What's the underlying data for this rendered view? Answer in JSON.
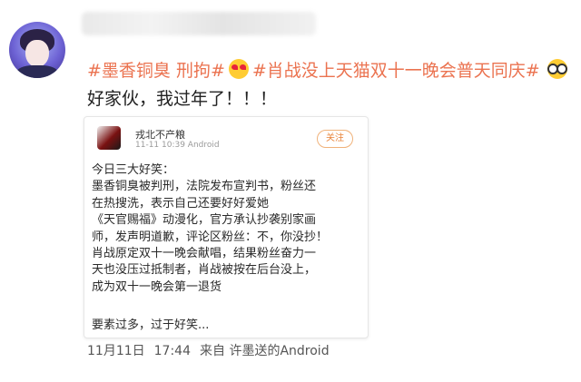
{
  "post": {
    "tags": [
      "#墨香铜臭 刑拘#",
      "#肖战没上天猫双十一晚会普天同庆#"
    ],
    "text": "好家伙，我过年了！！！",
    "emoji": [
      "heart-eyes-emoji",
      "glasses-emoji"
    ],
    "timestamp": {
      "date": "11月11日",
      "time": "17:44",
      "source": "来自 许墨送的Android"
    }
  },
  "screenshot_card": {
    "author": "戎北不产粮",
    "meta": "11-11 10:39  Android",
    "follow_label": "关注",
    "lines": [
      "今日三大好笑：",
      "墨香铜臭被判刑，法院发布宣判书，粉丝还",
      "在热搜洗，表示自己还要好好爱她",
      "《天官赐福》动漫化，官方承认抄袭别家画",
      "师，发声明道歉，评论区粉丝：不，你没抄！",
      "肖战原定双十一晚会献唱，结果粉丝奋力一",
      "天也没压过抵制者，肖战被按在后台没上，",
      "成为双十一晚会第一退货"
    ],
    "footer": "要素过多，过于好笑..."
  }
}
